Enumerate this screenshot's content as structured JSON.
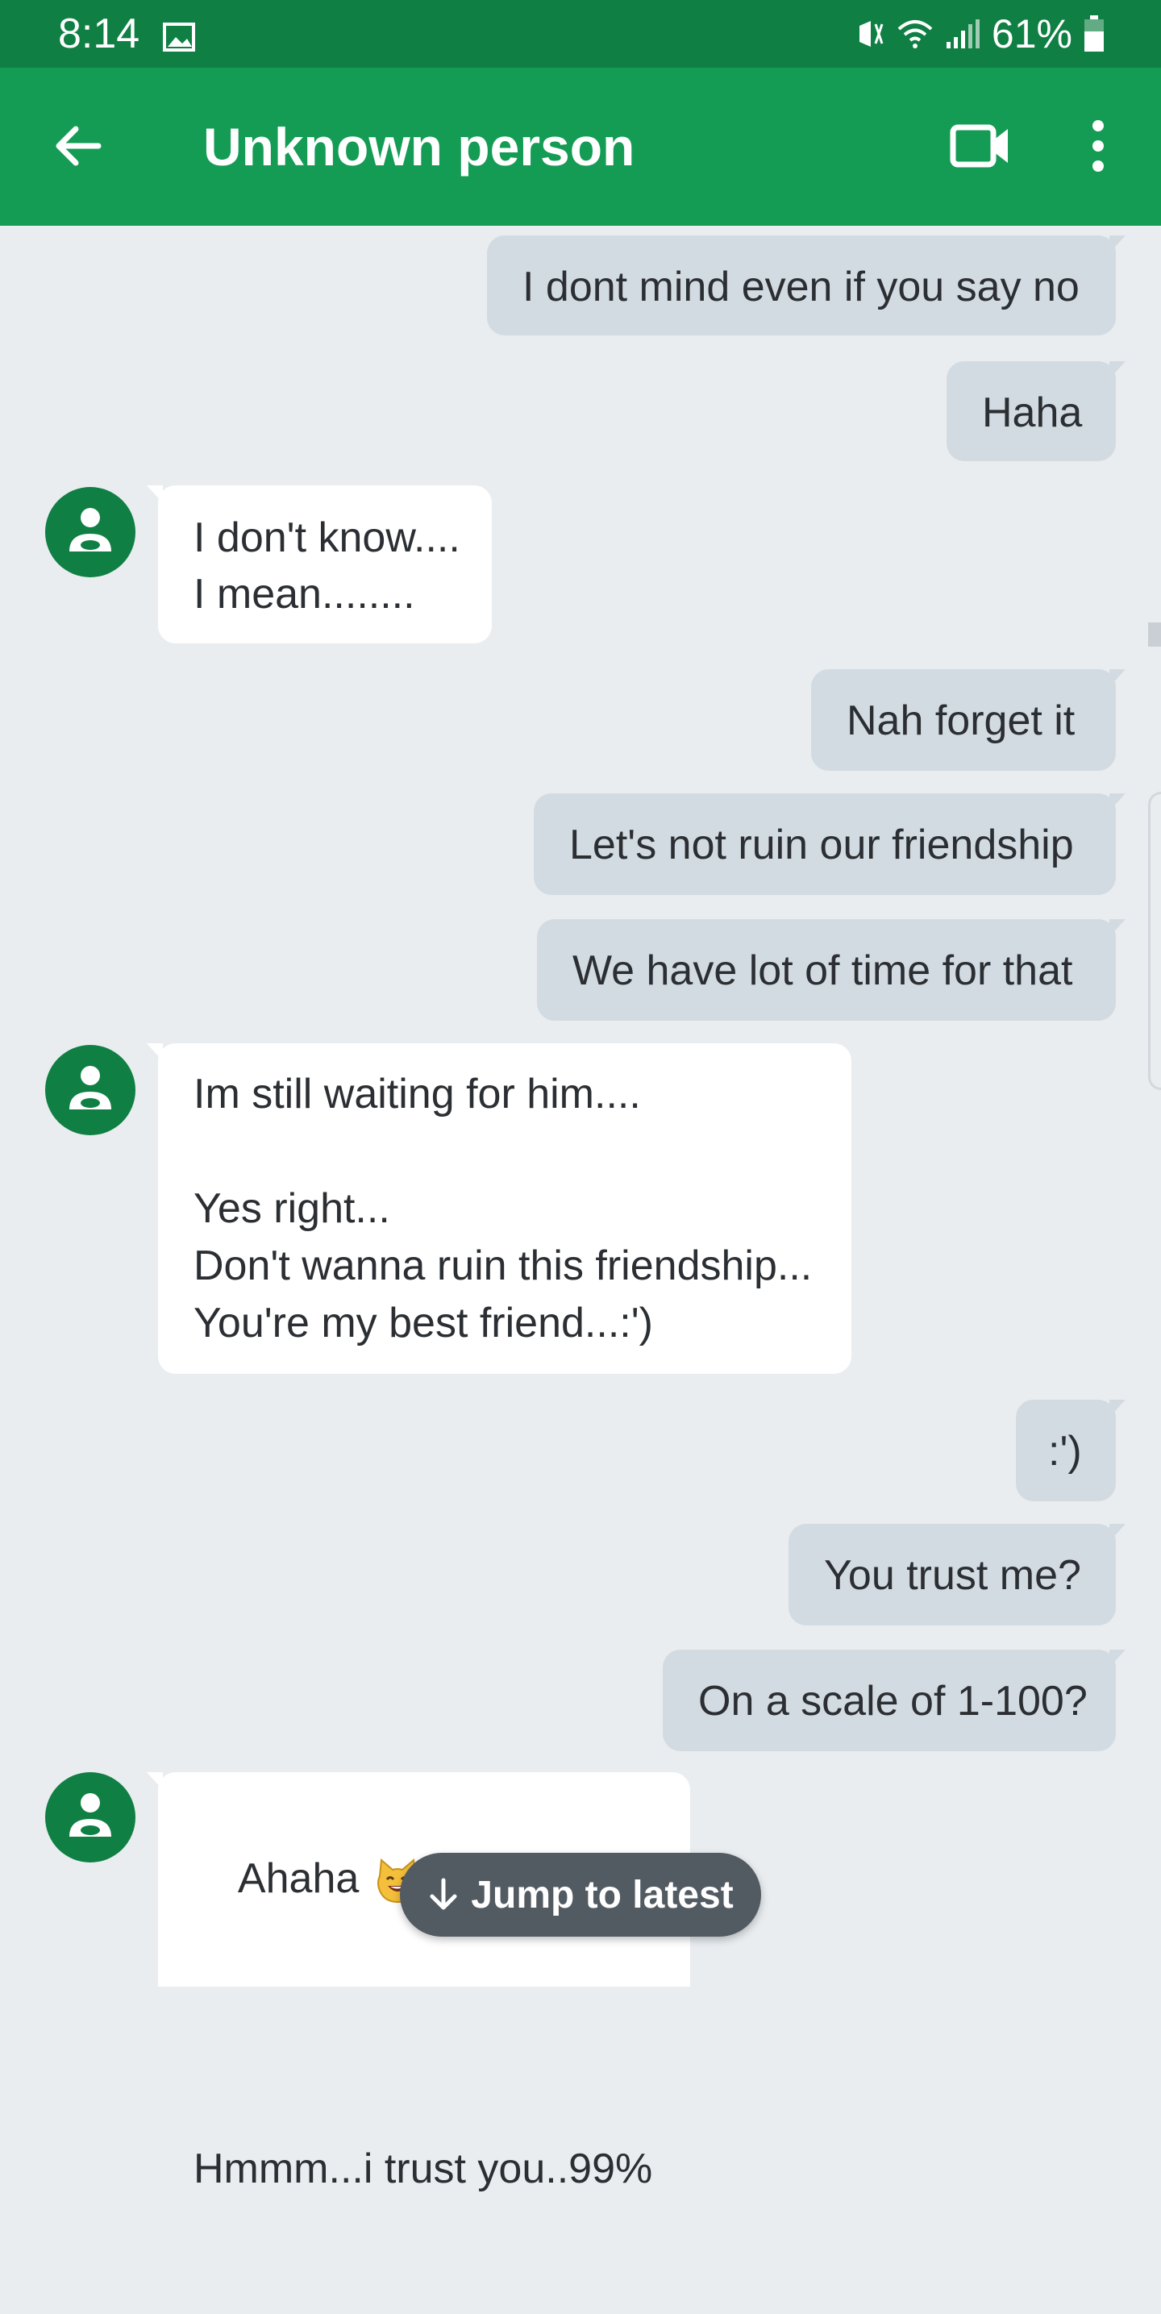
{
  "status_bar": {
    "time": "8:14",
    "battery": "61%",
    "icons": [
      "gallery-icon",
      "mute-icon",
      "wifi-icon",
      "signal-icon",
      "battery-icon"
    ]
  },
  "app_bar": {
    "title": "Unknown person",
    "icons": [
      "back-arrow-icon",
      "video-call-icon",
      "more-vert-icon"
    ],
    "color": "#149c55",
    "status_color": "#0f7f43"
  },
  "messages": [
    {
      "dir": "out",
      "text": "I dont mind even if you say no"
    },
    {
      "dir": "out",
      "text": "Haha"
    },
    {
      "dir": "in",
      "text": "I don't know....\nI mean........"
    },
    {
      "dir": "out",
      "text": "Nah forget it"
    },
    {
      "dir": "out",
      "text": "Let's not ruin our friendship"
    },
    {
      "dir": "out",
      "text": "We have lot of time for that"
    },
    {
      "dir": "in",
      "text": "Im still waiting for him....\n\nYes right...\nDon't wanna ruin this friendship...\nYou're my best friend...:')"
    },
    {
      "dir": "out",
      "text": ":')"
    },
    {
      "dir": "out",
      "text": "You trust me?"
    },
    {
      "dir": "out",
      "text": "On a scale of 1-100?"
    },
    {
      "dir": "in",
      "text": "Ahaha",
      "emoji": "smiling-cat-emoji"
    },
    {
      "dir": "in",
      "text": "Hmmm...i trust you..99%"
    }
  ],
  "jump_button": {
    "label": "Jump to latest",
    "icon": "arrow-down-icon"
  },
  "colors": {
    "outgoing_bubble": "#d3dbe2",
    "incoming_bubble": "#ffffff",
    "background": "#e9edf0",
    "avatar": "#0f7f43"
  }
}
